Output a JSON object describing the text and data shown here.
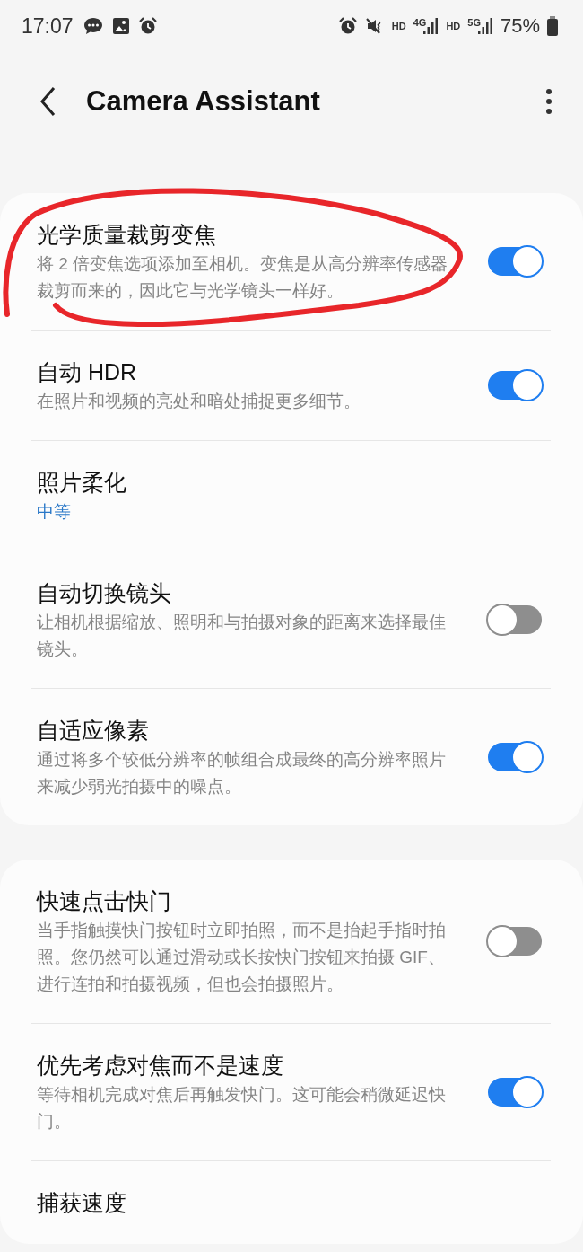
{
  "status_bar": {
    "time": "17:07",
    "network": [
      "HD",
      "4G",
      "HD",
      "5G"
    ],
    "battery": "75%"
  },
  "header": {
    "title": "Camera Assistant"
  },
  "annotation": {
    "kind": "circle"
  },
  "groups": [
    {
      "items": [
        {
          "kind": "toggle",
          "title": "光学质量裁剪变焦",
          "description": "将 2 倍变焦选项添加至相机。变焦是从高分辨率传感器裁剪而来的，因此它与光学镜头一样好。",
          "on": true
        },
        {
          "kind": "toggle",
          "title": "自动 HDR",
          "description": "在照片和视频的亮处和暗处捕捉更多细节。",
          "on": true
        },
        {
          "kind": "value",
          "title": "照片柔化",
          "value": "中等"
        },
        {
          "kind": "toggle",
          "title": "自动切换镜头",
          "description": "让相机根据缩放、照明和与拍摄对象的距离来选择最佳镜头。",
          "on": false
        },
        {
          "kind": "toggle",
          "title": "自适应像素",
          "description": "通过将多个较低分辨率的帧组合成最终的高分辨率照片来减少弱光拍摄中的噪点。",
          "on": true
        }
      ]
    },
    {
      "items": [
        {
          "kind": "toggle",
          "title": "快速点击快门",
          "description": "当手指触摸快门按钮时立即拍照，而不是抬起手指时拍照。您仍然可以通过滑动或长按快门按钮来拍摄 GIF、进行连拍和拍摄视频，但也会拍摄照片。",
          "on": false
        },
        {
          "kind": "toggle",
          "title": "优先考虑对焦而不是速度",
          "description": "等待相机完成对焦后再触发快门。这可能会稍微延迟快门。",
          "on": true
        },
        {
          "kind": "plain",
          "title": "捕获速度"
        }
      ]
    }
  ]
}
